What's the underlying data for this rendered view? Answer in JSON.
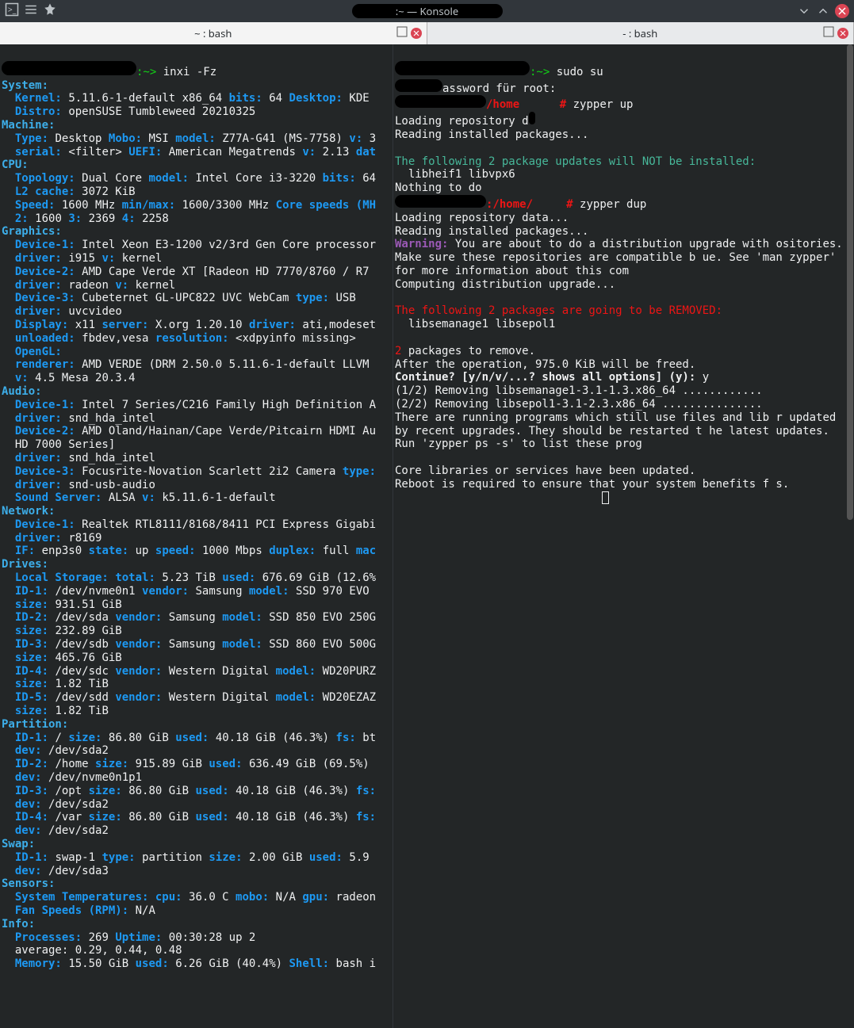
{
  "window": {
    "title": ":~ — Konsole"
  },
  "tabs": [
    {
      "label": "~ : bash"
    },
    {
      "label": "- : bash"
    }
  ],
  "left": {
    "cmd": "inxi -Fz",
    "prompt": ":~>",
    "sections": {
      "system": "System:",
      "kernel_l": "Kernel:",
      "kernel_v": "5.11.6-1-default x86_64",
      "bits_l": "bits:",
      "bits_v": "64",
      "desktop_l": "Desktop:",
      "desktop_v": "KDE",
      "distro_l": "Distro:",
      "distro_v": "openSUSE Tumbleweed 20210325",
      "machine": "Machine:",
      "type_l": "Type:",
      "type_v": "Desktop",
      "mobo_l": "Mobo:",
      "mobo_v": "MSI",
      "model_l": "model:",
      "model_v": "Z77A-G41 (MS-7758)",
      "v_l": "v:",
      "v_v": "3",
      "serial_l": "serial:",
      "serial_v": "<filter>",
      "uefi_l": "UEFI:",
      "uefi_v": "American Megatrends",
      "uefi_ver_l": "v:",
      "uefi_ver_v": "2.13",
      "dat": "dat",
      "cpu": "CPU:",
      "topo_l": "Topology:",
      "topo_v": "Dual Core",
      "cpumodel_l": "model:",
      "cpumodel_v": "Intel Core i3-3220",
      "cpubits_l": "bits:",
      "cpubits_v": "64",
      "l2_l": "L2 cache:",
      "l2_v": "3072 KiB",
      "speed_l": "Speed:",
      "speed_v": "1600 MHz",
      "minmax_l": "min/max:",
      "minmax_v": "1600/3300 MHz",
      "cores_l": "Core speeds (MH",
      "c2_l": "2:",
      "c2_v": "1600",
      "c3_l": "3:",
      "c3_v": "2369",
      "c4_l": "4:",
      "c4_v": "2258",
      "graphics": "Graphics:",
      "gd1_l": "Device-1:",
      "gd1_v": "Intel Xeon E3-1200 v2/3rd Gen Core processor",
      "gdrv1_l": "driver:",
      "gdrv1_v": "i915",
      "gv1_l": "v:",
      "gv1_v": "kernel",
      "gd2_l": "Device-2:",
      "gd2_v": "AMD Cape Verde XT [Radeon HD 7770/8760 / R7",
      "gdrv2_l": "driver:",
      "gdrv2_v": "radeon",
      "gv2_l": "v:",
      "gv2_v": "kernel",
      "gd3_l": "Device-3:",
      "gd3_v": "Cubeternet GL-UPC822 UVC WebCam",
      "gtype3_l": "type:",
      "gtype3_v": "USB",
      "gdrv3_l": "driver:",
      "gdrv3_v": "uvcvideo",
      "display_l": "Display:",
      "display_v": "x11",
      "server_l": "server:",
      "server_v": "X.org 1.20.10",
      "ddriver_l": "driver:",
      "ddriver_v": "ati,modeset",
      "unloaded_l": "unloaded:",
      "unloaded_v": "fbdev,vesa",
      "resolution_l": "resolution:",
      "resolution_v": "<xdpyinfo missing>",
      "opengl_l": "OpenGL:",
      "renderer_l": "renderer:",
      "renderer_v": "AMD VERDE (DRM 2.50.0 5.11.6-1-default LLVM",
      "oglv_l": "v:",
      "oglv_v": "4.5 Mesa 20.3.4",
      "audio": "Audio:",
      "ad1_l": "Device-1:",
      "ad1_v": "Intel 7 Series/C216 Family High Definition A",
      "adrv1_l": "driver:",
      "adrv1_v": "snd_hda_intel",
      "ad2_l": "Device-2:",
      "ad2_v": "AMD Oland/Hainan/Cape Verde/Pitcairn HDMI Au",
      "ad2_line2": "HD 7000 Series]",
      "adrv2_l": "driver:",
      "adrv2_v": "snd_hda_intel",
      "ad3_l": "Device-3:",
      "ad3_v": "Focusrite-Novation Scarlett 2i2 Camera",
      "atype3_l": "type:",
      "adrv3_l": "driver:",
      "adrv3_v": "snd-usb-audio",
      "ss_l": "Sound Server:",
      "ss_v": "ALSA",
      "ssv_l": "v:",
      "ssv_v": "k5.11.6-1-default",
      "network": "Network:",
      "nd1_l": "Device-1:",
      "nd1_v": "Realtek RTL8111/8168/8411 PCI Express Gigabi",
      "ndrv1_l": "driver:",
      "ndrv1_v": "r8169",
      "if_l": "IF:",
      "if_v": "enp3s0",
      "state_l": "state:",
      "state_v": "up",
      "nspeed_l": "speed:",
      "nspeed_v": "1000 Mbps",
      "duplex_l": "duplex:",
      "duplex_v": "full",
      "mac_l": "mac",
      "drives": "Drives:",
      "ls_l": "Local Storage:",
      "ls_total_l": "total:",
      "ls_total_v": "5.23 TiB",
      "ls_used_l": "used:",
      "ls_used_v": "676.69 GiB (12.6%",
      "d1_l": "ID-1:",
      "d1_v": "/dev/nvme0n1",
      "d1ven_l": "vendor:",
      "d1ven_v": "Samsung",
      "d1mod_l": "model:",
      "d1mod_v": "SSD 970 EVO",
      "d1size_l": "size:",
      "d1size_v": "931.51 GiB",
      "d2_l": "ID-2:",
      "d2_v": "/dev/sda",
      "d2ven_l": "vendor:",
      "d2ven_v": "Samsung",
      "d2mod_l": "model:",
      "d2mod_v": "SSD 850 EVO 250G",
      "d2size_l": "size:",
      "d2size_v": "232.89 GiB",
      "d3_l": "ID-3:",
      "d3_v": "/dev/sdb",
      "d3ven_l": "vendor:",
      "d3ven_v": "Samsung",
      "d3mod_l": "model:",
      "d3mod_v": "SSD 860 EVO 500G",
      "d3size_l": "size:",
      "d3size_v": "465.76 GiB",
      "d4_l": "ID-4:",
      "d4_v": "/dev/sdc",
      "d4ven_l": "vendor:",
      "d4ven_v": "Western Digital",
      "d4mod_l": "model:",
      "d4mod_v": "WD20PURZ",
      "d4size_l": "size:",
      "d4size_v": "1.82 TiB",
      "d5_l": "ID-5:",
      "d5_v": "/dev/sdd",
      "d5ven_l": "vendor:",
      "d5ven_v": "Western Digital",
      "d5mod_l": "model:",
      "d5mod_v": "WD20EZAZ",
      "d5size_l": "size:",
      "d5size_v": "1.82 TiB",
      "partition": "Partition:",
      "p1_l": "ID-1:",
      "p1_v": "/",
      "p1size_l": "size:",
      "p1size_v": "86.80 GiB",
      "p1used_l": "used:",
      "p1used_v": "40.18 GiB (46.3%)",
      "p1fs_l": "fs:",
      "p1fs_v": "bt",
      "p1dev_l": "dev:",
      "p1dev_v": "/dev/sda2",
      "p2_l": "ID-2:",
      "p2_v": "/home",
      "p2size_l": "size:",
      "p2size_v": "915.89 GiB",
      "p2used_l": "used:",
      "p2used_v": "636.49 GiB (69.5%)",
      "p2dev_l": "dev:",
      "p2dev_v": "/dev/nvme0n1p1",
      "p3_l": "ID-3:",
      "p3_v": "/opt",
      "p3size_l": "size:",
      "p3size_v": "86.80 GiB",
      "p3used_l": "used:",
      "p3used_v": "40.18 GiB (46.3%)",
      "p3fs_l": "fs:",
      "p3dev_l": "dev:",
      "p3dev_v": "/dev/sda2",
      "p4_l": "ID-4:",
      "p4_v": "/var",
      "p4size_l": "size:",
      "p4size_v": "86.80 GiB",
      "p4used_l": "used:",
      "p4used_v": "40.18 GiB (46.3%)",
      "p4fs_l": "fs:",
      "p4dev_l": "dev:",
      "p4dev_v": "/dev/sda2",
      "swap": "Swap:",
      "sw1_l": "ID-1:",
      "sw1_v": "swap-1",
      "swtype_l": "type:",
      "swtype_v": "partition",
      "swsize_l": "size:",
      "swsize_v": "2.00 GiB",
      "swused_l": "used:",
      "swused_v": "5.9",
      "swdev_l": "dev:",
      "swdev_v": "/dev/sda3",
      "sensors": "Sensors:",
      "st_l": "System Temperatures:",
      "stcpu_l": "cpu:",
      "stcpu_v": "36.0 C",
      "stmobo_l": "mobo:",
      "stmobo_v": "N/A",
      "stgpu_l": "gpu:",
      "stgpu_v": "radeon",
      "fan_l": "Fan Speeds (RPM):",
      "fan_v": "N/A",
      "info": "Info:",
      "proc_l": "Processes:",
      "proc_v": "269",
      "uptime_l": "Uptime:",
      "uptime_v": "00:30:28 up 2",
      "avg": "average: 0.29, 0.44, 0.48",
      "mem_l": "Memory:",
      "mem_v": "15.50 GiB",
      "memused_l": "used:",
      "memused_v": "6.26 GiB (40.4%)",
      "shell_l": "Shell:",
      "shell_v": "bash i"
    }
  },
  "right": {
    "prompt1": ":~>",
    "cmd1": "sudo su",
    "pass": "assword für root:",
    "dir1": "/home",
    "hash": "#",
    "zy1": "zypper up",
    "load1": "Loading repository d",
    "read1": "Reading installed packages...",
    "notinst": "The following 2 package updates will NOT be installed:",
    "notinst_pkgs": "libheif1 libvpx6",
    "nothing": "Nothing to do",
    "dir2": ":/home/",
    "zy2": "zypper dup",
    "load2": "Loading repository data...",
    "read2": "Reading installed packages...",
    "warn_l": "Warning:",
    "warn_v": "You are about to do a distribution upgrade with ositories. Make sure these repositories are compatible b ue. See 'man zypper' for more information about this com",
    "comput": "Computing distribution upgrade...",
    "removed_hdr": "The following 2 packages are going to be REMOVED:",
    "removed_pkgs1": "libsemanage1",
    "removed_pkgs2": "libsepol1",
    "two": "2",
    "toremove": "packages to remove.",
    "free": "After the operation, 975.0 KiB will be freed.",
    "cont_l": "Continue? [y/n/v/...? shows all options] (y):",
    "cont_v": "y",
    "rem1": "(1/2) Removing libsemanage1-3.1-1.3.x86_64 ............",
    "rem2": "(2/2) Removing libsepol1-3.1-2.3.x86_64 ...............",
    "running": "There are running programs which still use files and lib r updated by recent upgrades. They should be restarted t he latest updates. Run 'zypper ps -s' to list these prog",
    "core": "Core libraries or services have been updated.",
    "reboot": "Reboot is required to ensure that your system benefits f s."
  }
}
